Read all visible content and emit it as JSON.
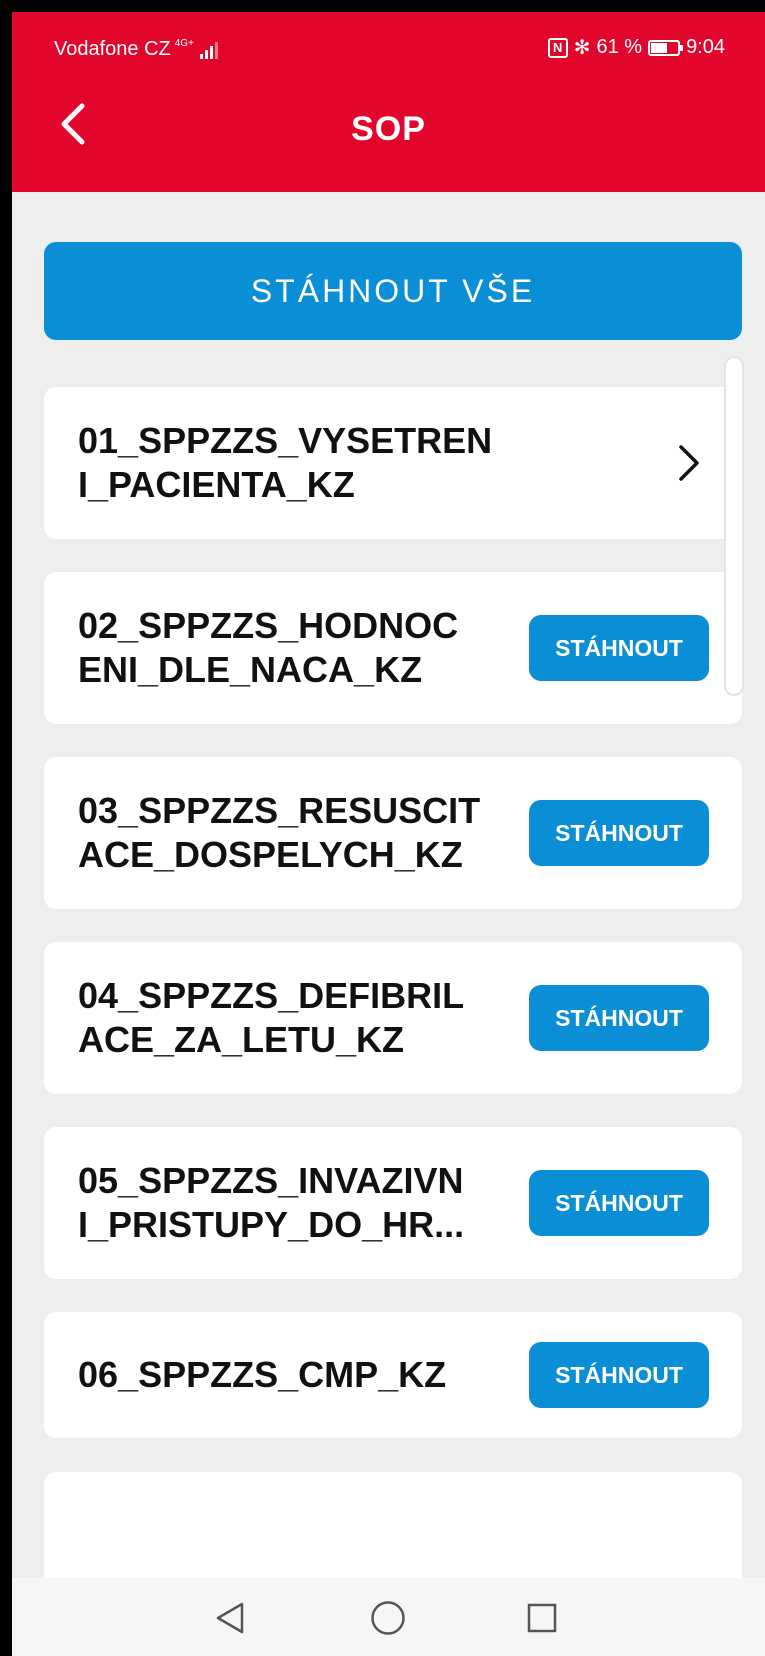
{
  "status_bar": {
    "carrier": "Vodafone CZ",
    "network": "4G+",
    "battery": "61 %",
    "time": "9:04"
  },
  "header": {
    "title": "SOP",
    "back_icon": "chevron-left-icon"
  },
  "download_all_label": "STÁHNOUT VŠE",
  "download_label": "STÁHNOUT",
  "items": [
    {
      "title": "01_SPPZZS_VYSETREN\nI_PACIENTA_KZ",
      "action": "chevron"
    },
    {
      "title": "02_SPPZZS_HODNOC\nENI_DLE_NACA_KZ",
      "action": "download"
    },
    {
      "title": "03_SPPZZS_RESUSCIT\nACE_DOSPELYCH_KZ",
      "action": "download"
    },
    {
      "title": "04_SPPZZS_DEFIBRIL\nACE_ZA_LETU_KZ",
      "action": "download"
    },
    {
      "title": "05_SPPZZS_INVAZIVN\nI_PRISTUPY_DO_HR...",
      "action": "download"
    },
    {
      "title": "06_SPPZZS_CMP_KZ",
      "action": "download"
    }
  ],
  "nav": {
    "back_icon": "triangle-back-icon",
    "home_icon": "circle-home-icon",
    "recents_icon": "square-recents-icon"
  },
  "colors": {
    "brand_red": "#e2062c",
    "accent_blue": "#0a8fd6",
    "background": "#eeeeee"
  }
}
